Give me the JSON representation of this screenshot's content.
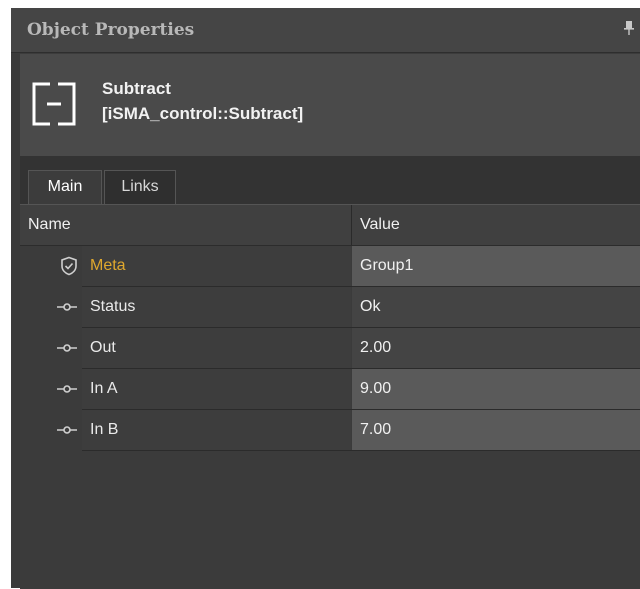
{
  "panel": {
    "title": "Object Properties",
    "pin_icon": "pin-icon"
  },
  "object": {
    "name": "Subtract",
    "type": "[iSMA_control::Subtract]",
    "icon": "subtract-block-icon"
  },
  "tabs": [
    {
      "label": "Main",
      "active": true
    },
    {
      "label": "Links",
      "active": false
    }
  ],
  "grid": {
    "columns": {
      "name": "Name",
      "value": "Value"
    },
    "rows": [
      {
        "icon": "shield-icon",
        "name": "Meta",
        "value": "Group1",
        "highlight": true
      },
      {
        "icon": "slot-connector-icon",
        "name": "Status",
        "value": "Ok",
        "highlight": false
      },
      {
        "icon": "slot-connector-icon",
        "name": "Out",
        "value": "2.00",
        "highlight": false
      },
      {
        "icon": "slot-connector-icon",
        "name": "In A",
        "value": "9.00",
        "highlight": true
      },
      {
        "icon": "slot-connector-icon",
        "name": "In B",
        "value": "7.00",
        "highlight": true
      }
    ]
  },
  "colors": {
    "meta_label": "#e0a82e",
    "panel_bg": "#3c3c3c"
  }
}
